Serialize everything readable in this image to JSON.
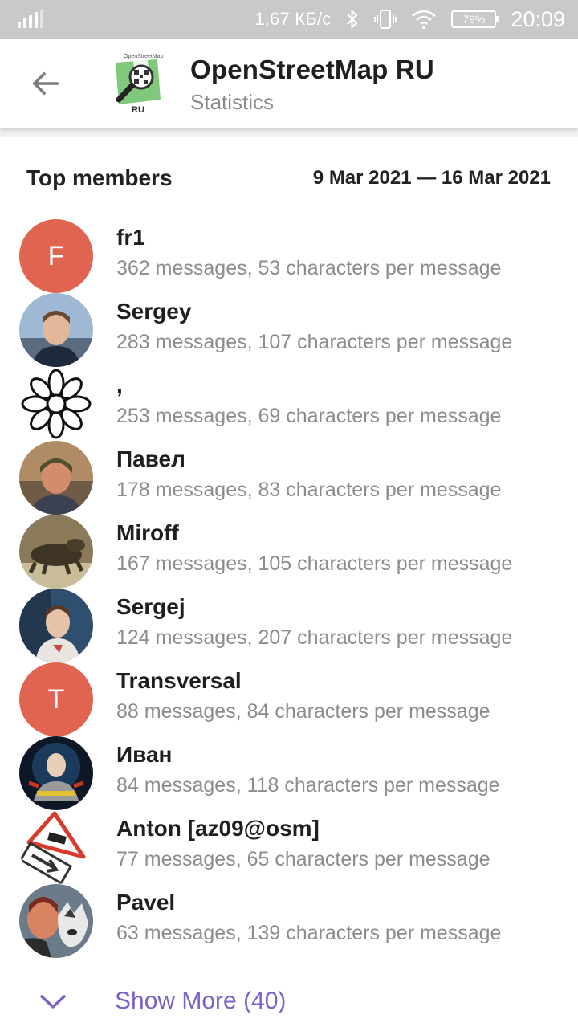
{
  "status_bar": {
    "speed": "1,67 КБ/с",
    "battery": "79%",
    "time": "20:09",
    "icons": [
      "signal-icon",
      "bluetooth-icon",
      "vibrate-icon",
      "wifi-icon",
      "battery-icon"
    ]
  },
  "header": {
    "title": "OpenStreetMap RU",
    "subtitle": "Statistics",
    "avatar_icon": "openstreetmap-ru-logo",
    "logo_text": {
      "top": "OpenStreetMap",
      "bottom": "RU"
    }
  },
  "section": {
    "title": "Top members",
    "date_range": "9 Mar 2021 — 16 Mar 2021"
  },
  "members": [
    {
      "name": "fr1",
      "stats": "362 messages, 53 characters per message",
      "avatar_letter": "F",
      "avatar_color": "#e16450"
    },
    {
      "name": "Sergey",
      "stats": "283 messages, 107 characters per message"
    },
    {
      "name": ",",
      "stats": "253 messages, 69 characters per message"
    },
    {
      "name": "Павел",
      "stats": "178 messages, 83 characters per message"
    },
    {
      "name": "Miroff",
      "stats": "167 messages, 105 characters per message"
    },
    {
      "name": "Sergej",
      "stats": "124 messages, 207 characters per message"
    },
    {
      "name": "Transversal",
      "stats": "88 messages, 84 characters per message",
      "avatar_letter": "T",
      "avatar_color": "#e16450"
    },
    {
      "name": "Иван",
      "stats": "84 messages, 118 characters per message"
    },
    {
      "name": "Anton [az09@osm]",
      "stats": "77 messages, 65 characters per message"
    },
    {
      "name": "Pavel",
      "stats": "63 messages, 139 characters per message"
    }
  ],
  "show_more": {
    "label": "Show More (40)",
    "color": "#7b62c8"
  },
  "colors": {
    "accent": "#7b62c8",
    "avatar_letter_bg": "#e16450",
    "status_bar_bg": "#c9c9c9"
  }
}
